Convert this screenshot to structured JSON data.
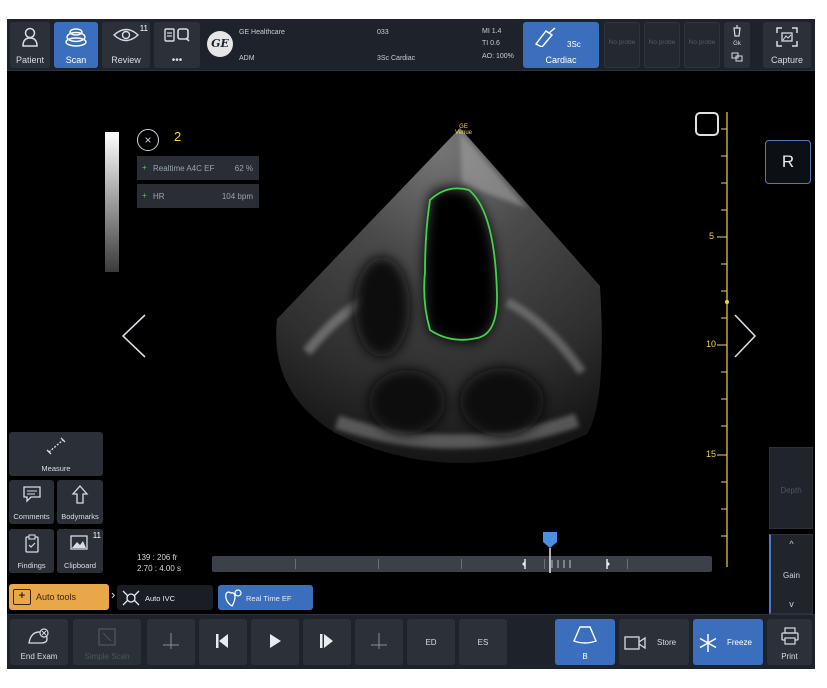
{
  "topbar": {
    "patient_label": "Patient",
    "scan_label": "Scan",
    "review_label": "Review",
    "review_badge": "11",
    "more_dots": "•••",
    "vendor_name": "GE Healthcare",
    "operator": "ADM",
    "logo_text": "GE",
    "exam_code": "033",
    "probe_preset": "3Sc  Cardiac",
    "mi_value": "MI 1.4",
    "ti_value": "TI 0.6",
    "ao_value": "AO: 100%",
    "probe_name": "3Sc",
    "probe_app": "Cardiac",
    "no_probe_1": "No probe",
    "no_probe_2": "No probe",
    "no_probe_3": "No probe",
    "gel_label": "Gk",
    "capture_label": "Capture"
  },
  "image": {
    "overlay_count": "2",
    "close_symbol": "×",
    "measurements": [
      {
        "key": "Realtime A4C EF",
        "value": "62 %"
      },
      {
        "key": "HR",
        "value": "104 bpm"
      }
    ],
    "orientation_marker": "R",
    "ge_tag": "GE\nVenue",
    "depth_labels": [
      "5",
      "10",
      "15"
    ]
  },
  "left_tools": {
    "measure_label": "Measure",
    "comments_label": "Comments",
    "bodymarks_label": "Bodymarks",
    "findings_label": "Findings",
    "clipboard_label": "Clipboard",
    "clipboard_badge": "11"
  },
  "right_panel": {
    "depth_label": "Depth",
    "gain_label": "Gain",
    "up_symbol": "^",
    "down_symbol": "v"
  },
  "cine": {
    "frame_counter": "139 : 206 fr",
    "time_counter": "2.70 : 4.00 s",
    "position_fraction": 0.675
  },
  "auto_tools": {
    "auto_tools_label": "Auto tools",
    "auto_ivc_label": "Auto IVC",
    "realtime_ef_label": "Real Time EF"
  },
  "bottombar": {
    "end_exam_label": "End Exam",
    "simple_scan_label": "Simple Scan",
    "ed_label": "ED",
    "es_label": "ES",
    "b_mode_label": "B",
    "store_label": "Store",
    "freeze_label": "Freeze",
    "print_label": "Print"
  },
  "colors": {
    "accent_blue": "#3b6fbe",
    "auto_tools_orange": "#e8a84a",
    "lv_trace_green": "#3fd44a",
    "depth_scale_yellow": "#f0d24a"
  }
}
